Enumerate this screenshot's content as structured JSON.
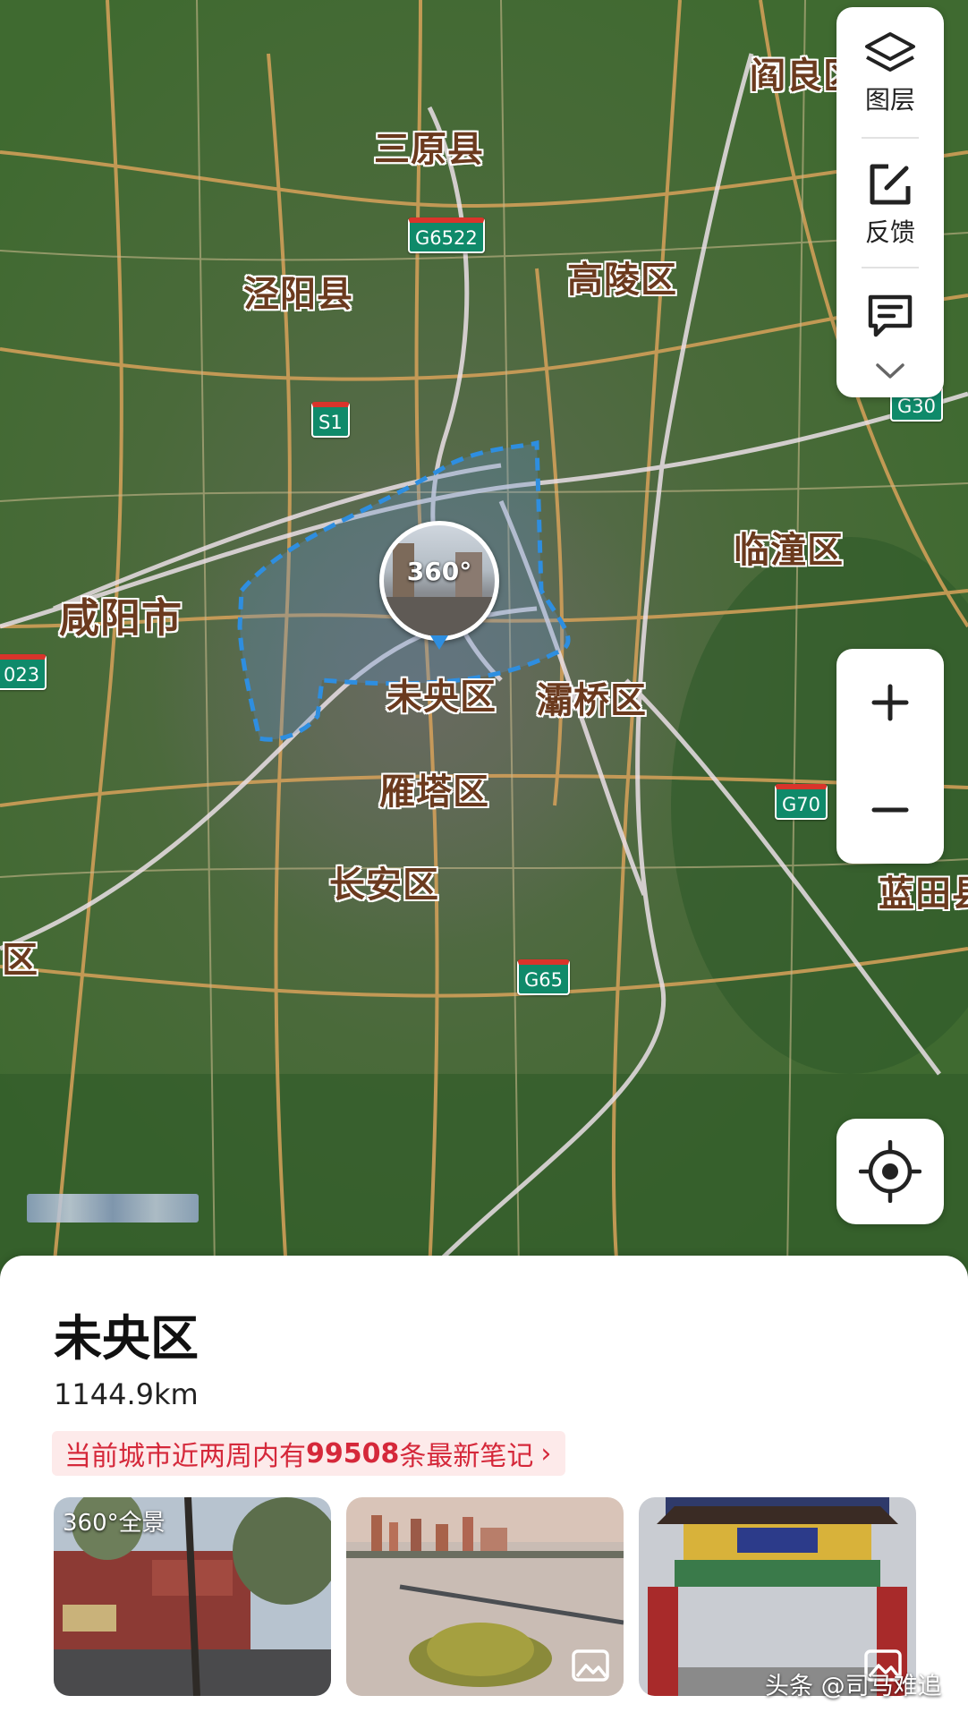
{
  "map": {
    "places": [
      {
        "name": "阎良区",
        "key": "yanliang"
      },
      {
        "name": "三原县",
        "key": "sanyuan"
      },
      {
        "name": "泾阳县",
        "key": "jingyang"
      },
      {
        "name": "高陵区",
        "key": "gaoling"
      },
      {
        "name": "临潼区",
        "key": "lintong"
      },
      {
        "name": "咸阳市",
        "key": "xianyang"
      },
      {
        "name": "未央区",
        "key": "weiyang"
      },
      {
        "name": "灞桥区",
        "key": "baqiao"
      },
      {
        "name": "雁塔区",
        "key": "yanta"
      },
      {
        "name": "长安区",
        "key": "changan"
      },
      {
        "name": "蓝田县",
        "key": "lantian"
      },
      {
        "name": "区",
        "key": "huyi_partial"
      }
    ],
    "road_shields": [
      "G6522",
      "S1",
      "G30",
      "023",
      "G70",
      "G65"
    ],
    "pano_marker": {
      "label": "360°",
      "icon": "panorama-360-icon"
    }
  },
  "toolbar": {
    "layers_label": "图层",
    "feedback_label": "反馈",
    "layers_icon": "layers-icon",
    "feedback_icon": "edit-feedback-icon",
    "message_icon": "message-icon",
    "more_icon": "chevron-down-icon"
  },
  "zoom": {
    "in_label": "+",
    "out_label": "−"
  },
  "sheet": {
    "title": "未央区",
    "distance": "1144.9km",
    "notes_prefix": "当前城市近两周内有",
    "notes_count": "99508",
    "notes_suffix": "条最新笔记",
    "photos": [
      {
        "badge": "360°全景",
        "type": "panorama"
      },
      {
        "badge": "",
        "type": "image"
      },
      {
        "badge": "",
        "type": "image"
      }
    ]
  },
  "watermark": "头条 @司马难追",
  "colors": {
    "accent_red": "#d5283a",
    "notes_bg": "#fdeaea",
    "boundary_blue": "#2e8ee0",
    "shield_green": "#0f8a6a"
  }
}
